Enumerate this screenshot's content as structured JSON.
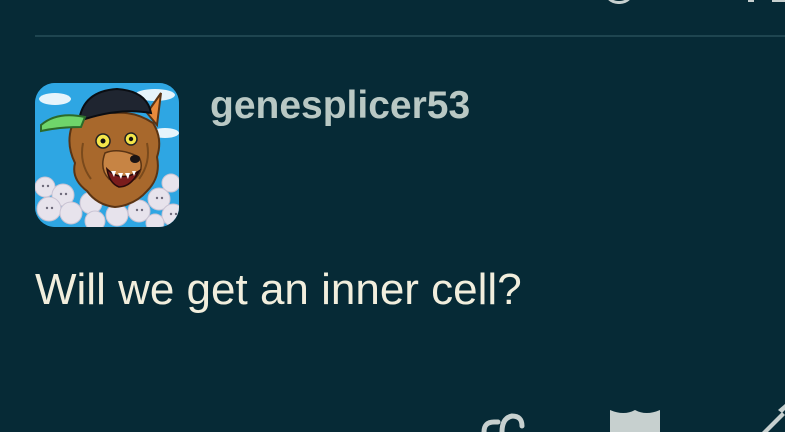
{
  "post": {
    "username": "genesplicer53",
    "message": "Will we get an inner cell?"
  },
  "icons": {
    "top_left": "partial-icon",
    "top_right": "partial-icon",
    "avatar": "wolf-with-cap-avatar",
    "actions": [
      "link-icon",
      "flag-icon",
      "edit-icon"
    ]
  },
  "colors": {
    "background": "#062a36",
    "username": "#b9c8c4",
    "message": "#f1eedd",
    "divider": "#1e4550",
    "icon": "#c7d0cf"
  }
}
